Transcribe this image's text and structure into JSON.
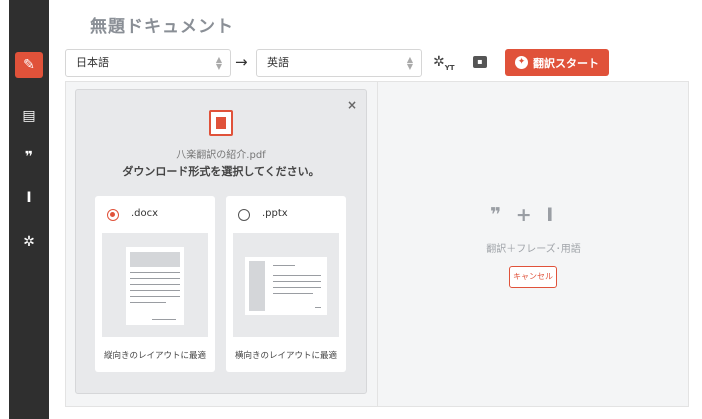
{
  "document": {
    "title": "無題ドキュメント"
  },
  "sidebar": {
    "items": [
      {
        "name": "edit-icon",
        "glyph": "✎"
      },
      {
        "name": "document-icon",
        "glyph": "▤"
      },
      {
        "name": "quote-icon",
        "glyph": "❞"
      },
      {
        "name": "text-cursor-icon",
        "glyph": "I"
      },
      {
        "name": "settings-icon",
        "glyph": "✲"
      }
    ]
  },
  "toolbar": {
    "source_lang": "日本語",
    "target_lang": "英語",
    "arrow": "→",
    "settings_sub": "YT",
    "start_label": "翻訳スタート"
  },
  "modal": {
    "close": "×",
    "filename": "八楽翻訳の紹介.pdf",
    "title": "ダウンロード形式を選択してください。",
    "options": [
      {
        "label": ".docx",
        "caption": "縦向きのレイアウトに最適",
        "selected": true
      },
      {
        "label": ".pptx",
        "caption": "横向きのレイアウトに最適",
        "selected": false
      }
    ]
  },
  "right_panel": {
    "icons": "❞ + I",
    "text": "翻訳＋フレーズ･用語",
    "cancel_label": "キャンセル"
  },
  "colors": {
    "accent": "#e0523a",
    "sidebar": "#2f2f2f"
  }
}
